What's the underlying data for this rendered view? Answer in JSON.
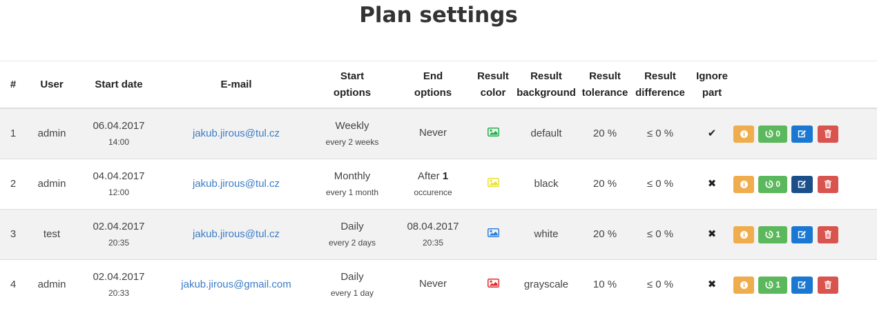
{
  "page": {
    "title": "Plan settings"
  },
  "table": {
    "headers": {
      "index": "#",
      "user": "User",
      "start_date": "Start date",
      "email": "E-mail",
      "start_options_1": "Start",
      "start_options_2": "options",
      "end_options_1": "End",
      "end_options_2": "options",
      "result_color_1": "Result",
      "result_color_2": "color",
      "result_background_1": "Result",
      "result_background_2": "background",
      "result_tolerance_1": "Result",
      "result_tolerance_2": "tolerance",
      "result_difference_1": "Result",
      "result_difference_2": "difference",
      "ignore_part_1": "Ignore",
      "ignore_part_2": "part"
    },
    "rows": [
      {
        "index": "1",
        "user": "admin",
        "start_date": "06.04.2017",
        "start_time": "14:00",
        "email": "jakub.jirous@tul.cz",
        "start_option": "Weekly",
        "start_detail": "every 2 weeks",
        "end_main": "Never",
        "end_bold": "",
        "end_detail": "",
        "color_icon": "image-icon",
        "color_icon_color": "#22b14c",
        "background": "default",
        "tolerance": "20 %",
        "difference": "≤ 0 %",
        "ignore_part": "✔",
        "ignore_icon": "check-icon",
        "history_count": "0",
        "edit_active": false
      },
      {
        "index": "2",
        "user": "admin",
        "start_date": "04.04.2017",
        "start_time": "12:00",
        "email": "jakub.jirous@tul.cz",
        "start_option": "Monthly",
        "start_detail": "every 1 month",
        "end_main": "After ",
        "end_bold": "1",
        "end_detail": "occurence",
        "color_icon": "image-icon",
        "color_icon_color": "#e8e225",
        "background": "black",
        "tolerance": "20 %",
        "difference": "≤ 0 %",
        "ignore_part": "✖",
        "ignore_icon": "cross-icon",
        "history_count": "0",
        "edit_active": true
      },
      {
        "index": "3",
        "user": "test",
        "start_date": "02.04.2017",
        "start_time": "20:35",
        "email": "jakub.jirous@tul.cz",
        "start_option": "Daily",
        "start_detail": "every 2 days",
        "end_main": "08.04.2017",
        "end_bold": "",
        "end_detail": "20:35",
        "color_icon": "image-icon",
        "color_icon_color": "#2a7fe0",
        "background": "white",
        "tolerance": "20 %",
        "difference": "≤ 0 %",
        "ignore_part": "✖",
        "ignore_icon": "cross-icon",
        "history_count": "1",
        "edit_active": false
      },
      {
        "index": "4",
        "user": "admin",
        "start_date": "02.04.2017",
        "start_time": "20:33",
        "email": "jakub.jirous@gmail.com",
        "start_option": "Daily",
        "start_detail": "every 1 day",
        "end_main": "Never",
        "end_bold": "",
        "end_detail": "",
        "color_icon": "image-icon",
        "color_icon_color": "#e22b2b",
        "background": "grayscale",
        "tolerance": "10 %",
        "difference": "≤ 0 %",
        "ignore_part": "✖",
        "ignore_icon": "cross-icon",
        "history_count": "1",
        "edit_active": false
      }
    ]
  },
  "colors": {
    "info_button": "#f0ad4e",
    "history_button": "#5cb85c",
    "edit_button": "#1a78d2",
    "edit_button_active": "#1b4f8a",
    "delete_button": "#d9534f",
    "link": "#3a7cc6",
    "striped_row": "#f2f2f2"
  },
  "icons": {
    "info": "info-icon",
    "history": "history-icon",
    "edit": "edit-icon",
    "delete": "trash-icon"
  }
}
